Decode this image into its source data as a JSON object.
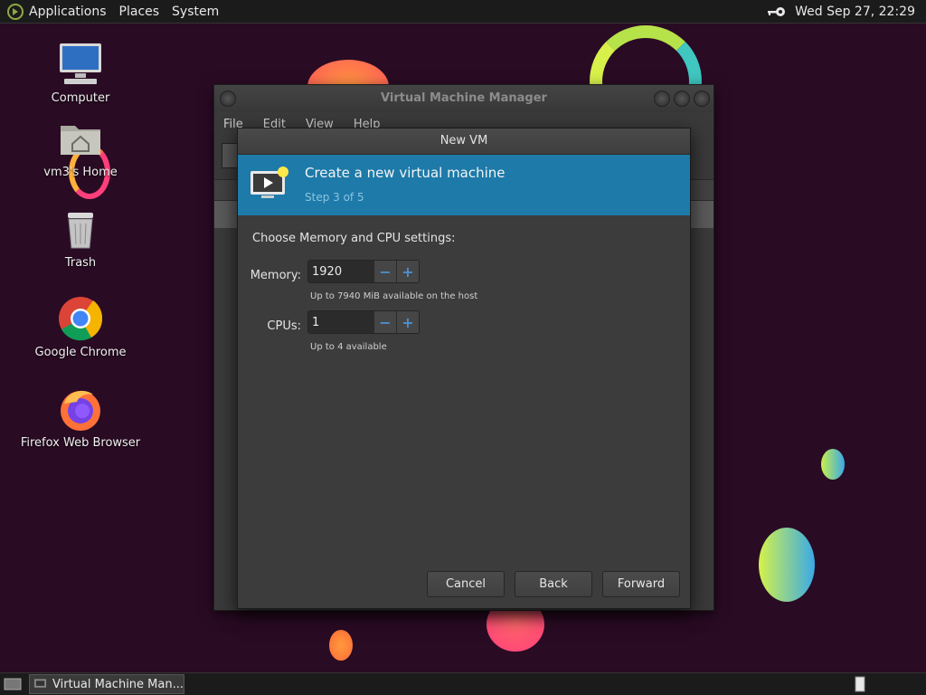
{
  "top_panel": {
    "menu": [
      "Applications",
      "Places",
      "System"
    ],
    "clock": "Wed Sep 27, 22:29"
  },
  "desktop": {
    "icons": [
      {
        "label": "Computer",
        "icon": "computer-icon"
      },
      {
        "label": "vm3's Home",
        "icon": "home-folder-icon"
      },
      {
        "label": "Trash",
        "icon": "trash-icon"
      },
      {
        "label": "Google Chrome",
        "icon": "chrome-icon"
      },
      {
        "label": "Firefox Web Browser",
        "icon": "firefox-icon"
      }
    ]
  },
  "manager_window": {
    "title": "Virtual Machine Manager",
    "menu": [
      "File",
      "Edit",
      "View",
      "Help"
    ]
  },
  "dialog": {
    "title": "New VM",
    "header_title": "Create a new virtual machine",
    "header_step": "Step 3 of 5",
    "section_label": "Choose Memory and CPU settings:",
    "memory_label": "Memory:",
    "memory_value": "1920",
    "memory_hint": "Up to 7940 MiB available on the host",
    "cpus_label": "CPUs:",
    "cpus_value": "1",
    "cpus_hint": "Up to 4 available",
    "buttons": {
      "cancel": "Cancel",
      "back": "Back",
      "forward": "Forward"
    },
    "minus_glyph": "−",
    "plus_glyph": "+"
  },
  "taskbar": {
    "item": "Virtual Machine Man..."
  },
  "colors": {
    "header_accent": "#1d7aa9",
    "desktop_bg": "#2a0b24"
  }
}
